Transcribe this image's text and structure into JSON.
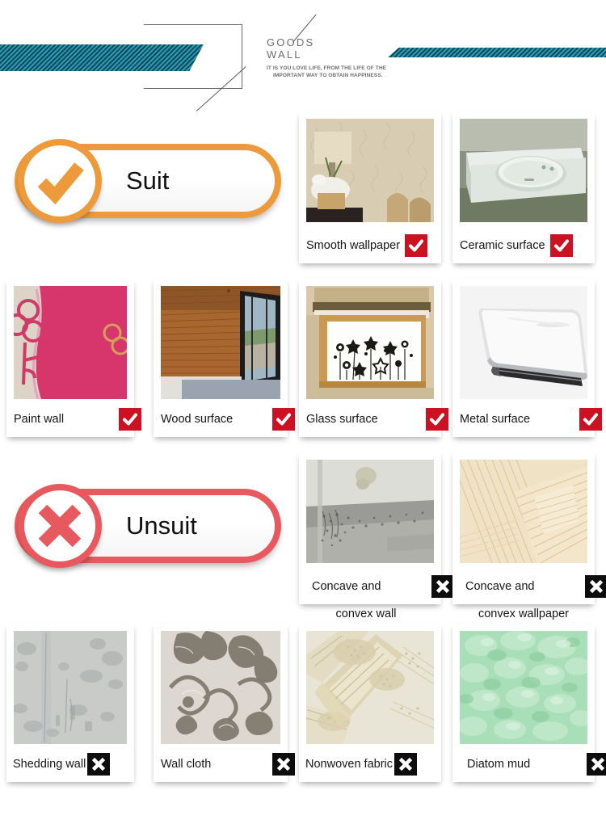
{
  "header": {
    "title_line1": "GOODS",
    "title_line2": "WALL",
    "subtitle_line1": "IT IS YOU LOVE LIFE, FROM THE LIFE OF THE",
    "subtitle_line2": "IMPORTANT WAY TO OBTAIN HAPPINESS.",
    "stripe_color": "#2e9cb5",
    "stripe_dark": "#0b4a5a"
  },
  "sections": [
    {
      "badge_label": "Suit",
      "badge_icon": "check-circle-icon",
      "accent_color": "#ed9a3d"
    },
    {
      "badge_label": "Unsuit",
      "badge_icon": "cross-circle-icon",
      "accent_color": "#e8595f"
    }
  ],
  "suit_items": [
    {
      "label": "Smooth wallpaper",
      "mark": "check-mark-icon",
      "mark_color": "#cc1122"
    },
    {
      "label": "Ceramic surface",
      "mark": "check-mark-icon",
      "mark_color": "#cc1122"
    },
    {
      "label": "Paint wall",
      "mark": "check-mark-icon",
      "mark_color": "#cc1122"
    },
    {
      "label": "Wood surface",
      "mark": "check-mark-icon",
      "mark_color": "#cc1122"
    },
    {
      "label": "Glass surface",
      "mark": "check-mark-icon",
      "mark_color": "#cc1122"
    },
    {
      "label": "Metal surface",
      "mark": "check-mark-icon",
      "mark_color": "#cc1122"
    }
  ],
  "unsuit_items": [
    {
      "label": "Concave and",
      "label2": "convex wall",
      "mark": "x-mark-icon",
      "mark_color": "#0d0d0d"
    },
    {
      "label": "Concave and",
      "label2": "convex wallpaper",
      "mark": "x-mark-icon",
      "mark_color": "#0d0d0d"
    },
    {
      "label": "Shedding wall",
      "label2": "",
      "mark": "x-mark-icon",
      "mark_color": "#0d0d0d"
    },
    {
      "label": "Wall cloth",
      "label2": "",
      "mark": "x-mark-icon",
      "mark_color": "#0d0d0d"
    },
    {
      "label": "Nonwoven fabric",
      "label2": "",
      "mark": "x-mark-icon",
      "mark_color": "#0d0d0d"
    },
    {
      "label": "Diatom mud",
      "label2": "",
      "mark": "x-mark-icon",
      "mark_color": "#0d0d0d"
    }
  ]
}
